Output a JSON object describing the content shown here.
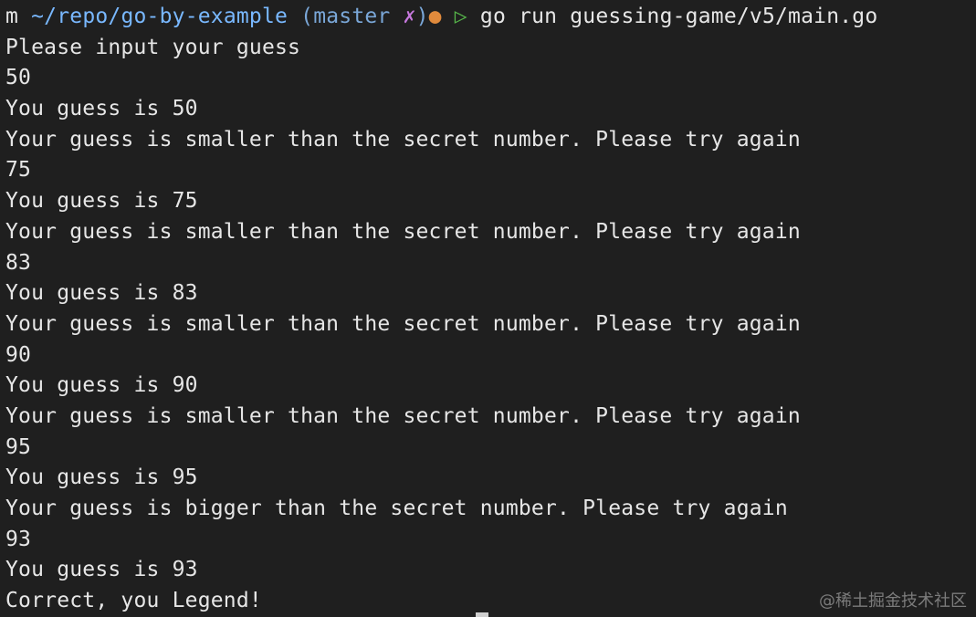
{
  "prompt": {
    "user": "m",
    "path": "~/repo/go-by-example",
    "branch_open": "(master",
    "dirty_mark": "✗",
    "branch_close": ")",
    "status_dot": "●",
    "arrow": "▷",
    "command": "go run guessing-game/v5/main.go"
  },
  "output_lines": [
    "Please input your guess",
    "50",
    "You guess is 50",
    "Your guess is smaller than the secret number. Please try again",
    "75",
    "You guess is 75",
    "Your guess is smaller than the secret number. Please try again",
    "83",
    "You guess is 83",
    "Your guess is smaller than the secret number. Please try again",
    "90",
    "You guess is 90",
    "Your guess is smaller than the secret number. Please try again",
    "95",
    "You guess is 95",
    "Your guess is bigger than the secret number. Please try again",
    "93",
    "You guess is 93",
    "Correct, you Legend!"
  ],
  "watermark": "@稀土掘金技术社区",
  "colors": {
    "background": "#1f1f1f",
    "text": "#e6e6e6",
    "path": "#79b8ff",
    "dirty": "#c678dd",
    "status_dot": "#e08a3c",
    "arrow": "#56b64a"
  }
}
